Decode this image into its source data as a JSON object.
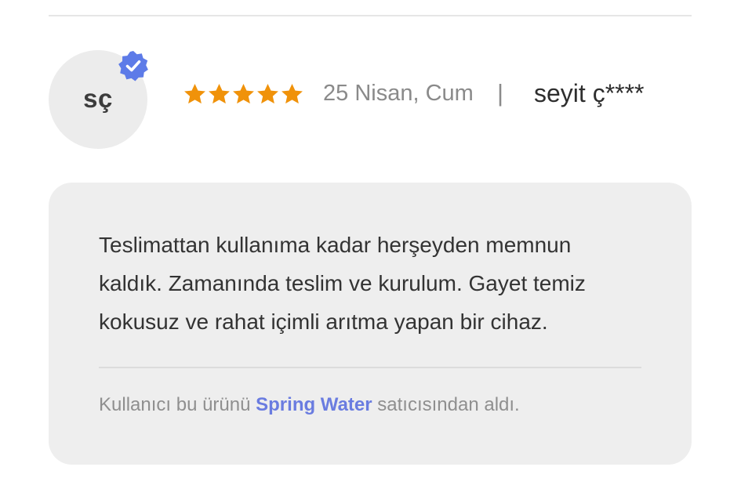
{
  "review": {
    "avatar_initials": "sç",
    "verified": true,
    "rating": 5,
    "rating_max": 5,
    "date": "25 Nisan, Cum",
    "separator": "|",
    "reviewer_name": "seyit ç****",
    "text": "Teslimattan kullanıma kadar herşeyden memnun kaldık. Zamanında teslim ve kurulum. Gayet temiz kokusuz ve rahat içimli arıtma yapan bir cihaz.",
    "purchase_prefix": "Kullanıcı bu ürünü",
    "seller_name": "Spring Water",
    "purchase_suffix": "satıcısından aldı."
  },
  "colors": {
    "star": "#f0920a",
    "verified_badge": "#5d7be8",
    "seller_link": "#6a7ce0",
    "card_background": "#eeeeee",
    "avatar_background": "#ececec"
  },
  "icons": {
    "verified": "verified-check-badge-icon",
    "star": "star-icon"
  }
}
